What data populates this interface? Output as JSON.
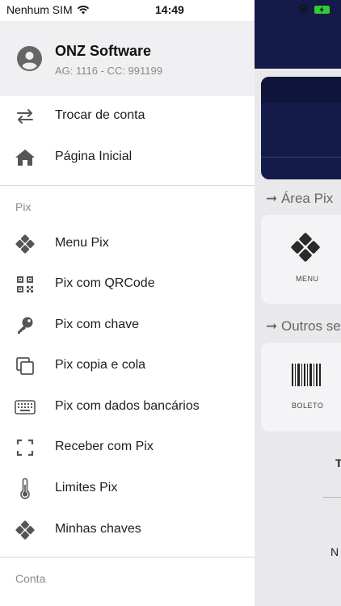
{
  "status_bar": {
    "carrier": "Nenhum SIM",
    "time": "14:49"
  },
  "profile": {
    "name": "ONZ Software",
    "account": "AG: 1116 - CC: 991199"
  },
  "menu_top": [
    {
      "label": "Trocar de conta",
      "icon": "swap-icon"
    },
    {
      "label": "Página Inicial",
      "icon": "home-icon"
    }
  ],
  "sections": {
    "pix": "Pix",
    "conta": "Conta"
  },
  "menu_pix": [
    {
      "label": "Menu Pix",
      "icon": "pix-icon"
    },
    {
      "label": "Pix com QRCode",
      "icon": "qrcode-icon"
    },
    {
      "label": "Pix com chave",
      "icon": "key-icon"
    },
    {
      "label": "Pix copia e cola",
      "icon": "copy-icon"
    },
    {
      "label": "Pix com dados bancários",
      "icon": "keyboard-icon"
    },
    {
      "label": "Receber com Pix",
      "icon": "scan-icon"
    },
    {
      "label": "Limites Pix",
      "icon": "thermometer-icon"
    },
    {
      "label": "Minhas chaves",
      "icon": "pix-icon"
    }
  ],
  "background_app": {
    "section_area_pix": "➞ Área Pix",
    "section_outros": "➞ Outros se",
    "tile_menu": "MENU",
    "tile_boleto": "BOLETO",
    "partial_t": "T",
    "partial_n": "N"
  },
  "colors": {
    "navy": "#141a4a",
    "profile_bg": "#f0f0f2",
    "icon_gray": "#555555"
  }
}
